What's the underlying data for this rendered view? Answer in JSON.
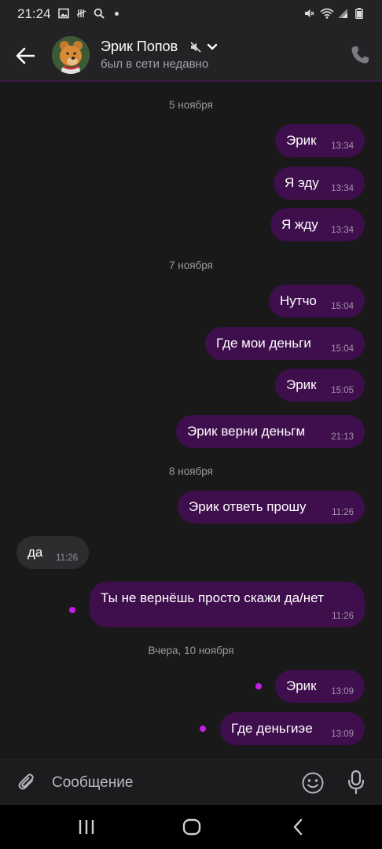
{
  "status_bar": {
    "time": "21:24"
  },
  "header": {
    "contact_name": "Эрик Попов",
    "contact_status": "был в сети недавно"
  },
  "messages": [
    {
      "type": "date",
      "text": "5 ноября"
    },
    {
      "type": "out",
      "text": "Эрик",
      "time": "13:34"
    },
    {
      "type": "out",
      "text": "Я эду",
      "time": "13:34"
    },
    {
      "type": "out",
      "text": "Я жду",
      "time": "13:34"
    },
    {
      "type": "date",
      "text": "7 ноября"
    },
    {
      "type": "out",
      "text": "Нутчо",
      "time": "15:04"
    },
    {
      "type": "out",
      "text": "Где мои деньги",
      "time": "15:04"
    },
    {
      "type": "out",
      "text": "Эрик",
      "time": "15:05"
    },
    {
      "type": "out",
      "text": "Эрик верни деньгм",
      "time": "21:13"
    },
    {
      "type": "date",
      "text": "8 ноября"
    },
    {
      "type": "out",
      "text": "Эрик ответь прошу",
      "time": "11:26"
    },
    {
      "type": "in",
      "text": "да",
      "time": "11:26"
    },
    {
      "type": "out",
      "text": "Ты не вернёшь просто скажи да/нет",
      "time": "11:26",
      "unread": true
    },
    {
      "type": "date",
      "text": "Вчера, 10 ноября"
    },
    {
      "type": "out",
      "text": "Эрик",
      "time": "13:09",
      "unread": true
    },
    {
      "type": "out",
      "text": "Где деньгиэе",
      "time": "13:09",
      "unread": true
    }
  ],
  "composer": {
    "placeholder": "Сообщение"
  },
  "colors": {
    "outgoing_bubble": "#3f0e4d",
    "incoming_bubble": "#2d2d30",
    "unread_dot": "#c51ee8",
    "background": "#19191a"
  }
}
